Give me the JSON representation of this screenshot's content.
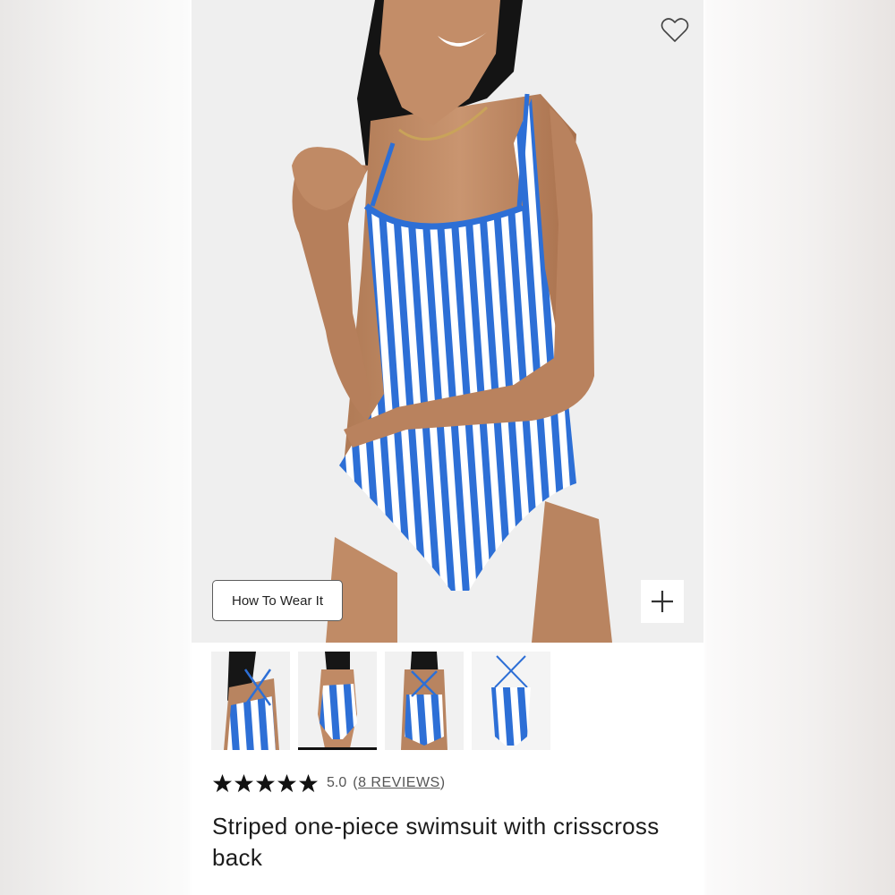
{
  "product": {
    "title": "Striped one-piece swimsuit with crisscross back",
    "rating_value": "5.0",
    "rating_stars": 5,
    "reviews_open": "(",
    "reviews_label": "8 REVIEWS",
    "reviews_close": ")"
  },
  "hero": {
    "how_to_wear_label": "How To Wear It",
    "wishlist_icon": "heart-outline-icon",
    "zoom_icon": "plus-icon"
  },
  "thumbnails": [
    {
      "view": "back-crisscross-model",
      "active": false
    },
    {
      "view": "front-model",
      "active": true
    },
    {
      "view": "back-model",
      "active": false
    },
    {
      "view": "flat-lay-back",
      "active": false
    }
  ],
  "colors": {
    "stripe_blue": "#2d6fd6",
    "stripe_white": "#ffffff",
    "star": "#111111",
    "background": "#efefef"
  }
}
